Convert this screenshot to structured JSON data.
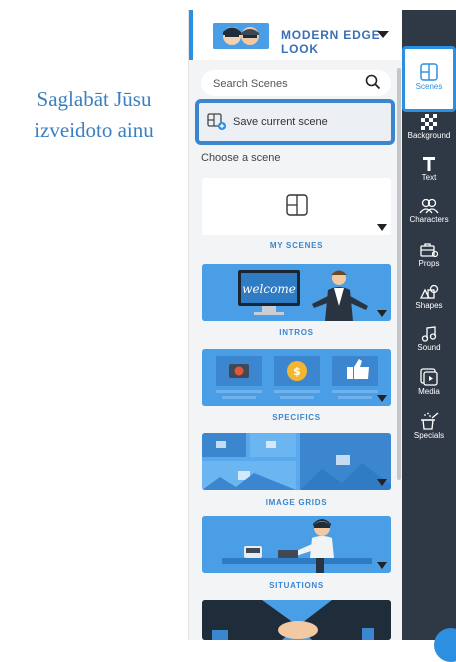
{
  "caption": {
    "line1": "Saglabāt Jūsu",
    "line2": "izveidoto ainu"
  },
  "header": {
    "title": "MODERN EDGE LOOK"
  },
  "search": {
    "placeholder": "Search Scenes"
  },
  "save": {
    "label": "Save current scene"
  },
  "choose": {
    "label": "Choose a scene"
  },
  "categories": [
    "MY SCENES",
    "INTROS",
    "SPECIFICS",
    "IMAGE GRIDS",
    "SITUATIONS"
  ],
  "intro_text": "welcome",
  "rail": [
    "Scenes",
    "Background",
    "Text",
    "Characters",
    "Props",
    "Shapes",
    "Sound",
    "Media",
    "Specials"
  ],
  "colors": {
    "accent": "#2d8fe0",
    "rail_bg": "#2f3946",
    "card_blue": "#4a9ee6"
  }
}
